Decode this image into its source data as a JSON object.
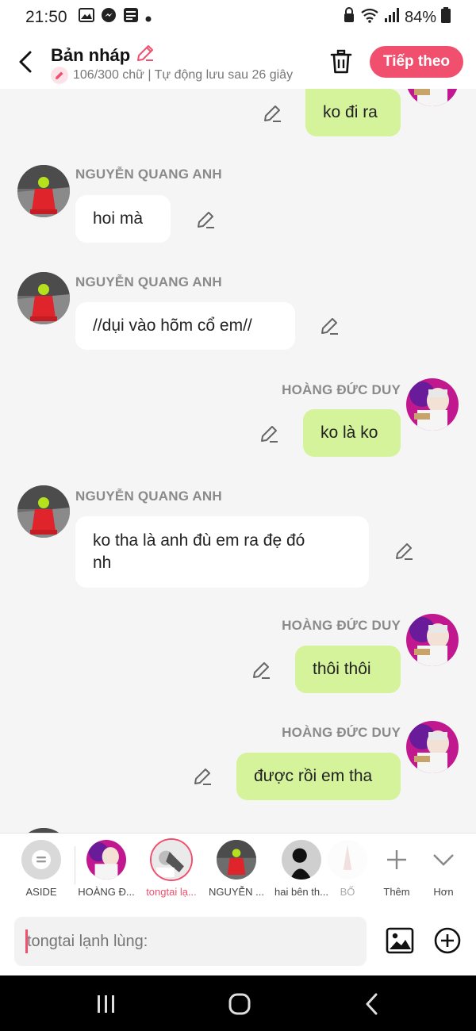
{
  "status_bar": {
    "time": "21:50",
    "battery": "84%",
    "icons": [
      "gallery-icon",
      "messenger-icon",
      "baomoi-icon",
      "dot-icon",
      "lock-icon",
      "wifi-icon",
      "signal-icon",
      "battery-icon"
    ]
  },
  "header": {
    "title": "Bản nháp",
    "subtitle": "106/300 chữ | Tự động lưu sau 26 giây",
    "next_label": "Tiếp theo"
  },
  "messages": [
    {
      "side": "right",
      "sender": "",
      "text": "ko đi ra"
    },
    {
      "side": "left",
      "sender": "NGUYỄN QUANG ANH",
      "text": "hoi mà"
    },
    {
      "side": "left",
      "sender": "NGUYỄN QUANG ANH",
      "text": "//dụi vào hõm cổ em//"
    },
    {
      "side": "right",
      "sender": "HOÀNG ĐỨC DUY",
      "text": "ko là ko"
    },
    {
      "side": "left",
      "sender": "NGUYỄN QUANG ANH",
      "text_line1": "ko tha là anh đù em ra đẹ đó",
      "text_line2": "nh"
    },
    {
      "side": "right",
      "sender": "HOÀNG ĐỨC DUY",
      "text": "thôi thôi"
    },
    {
      "side": "right",
      "sender": "HOÀNG ĐỨC DUY",
      "text": "được rồi em tha"
    }
  ],
  "characters": [
    {
      "label": "ASIDE"
    },
    {
      "label": "HOÀNG Đ..."
    },
    {
      "label": "tongtai lạ...",
      "active": true
    },
    {
      "label": "NGUYỄN ..."
    },
    {
      "label": "hai bên th..."
    },
    {
      "label": "BỐ"
    }
  ],
  "char_actions": {
    "add_label": "Thêm",
    "more_label": "Hơn"
  },
  "input": {
    "placeholder": "tongtai lạnh lùng:"
  },
  "colors": {
    "accent": "#f0506e",
    "right_bubble": "#d4f39a",
    "left_bubble": "#ffffff",
    "background": "#f5f5f5"
  }
}
